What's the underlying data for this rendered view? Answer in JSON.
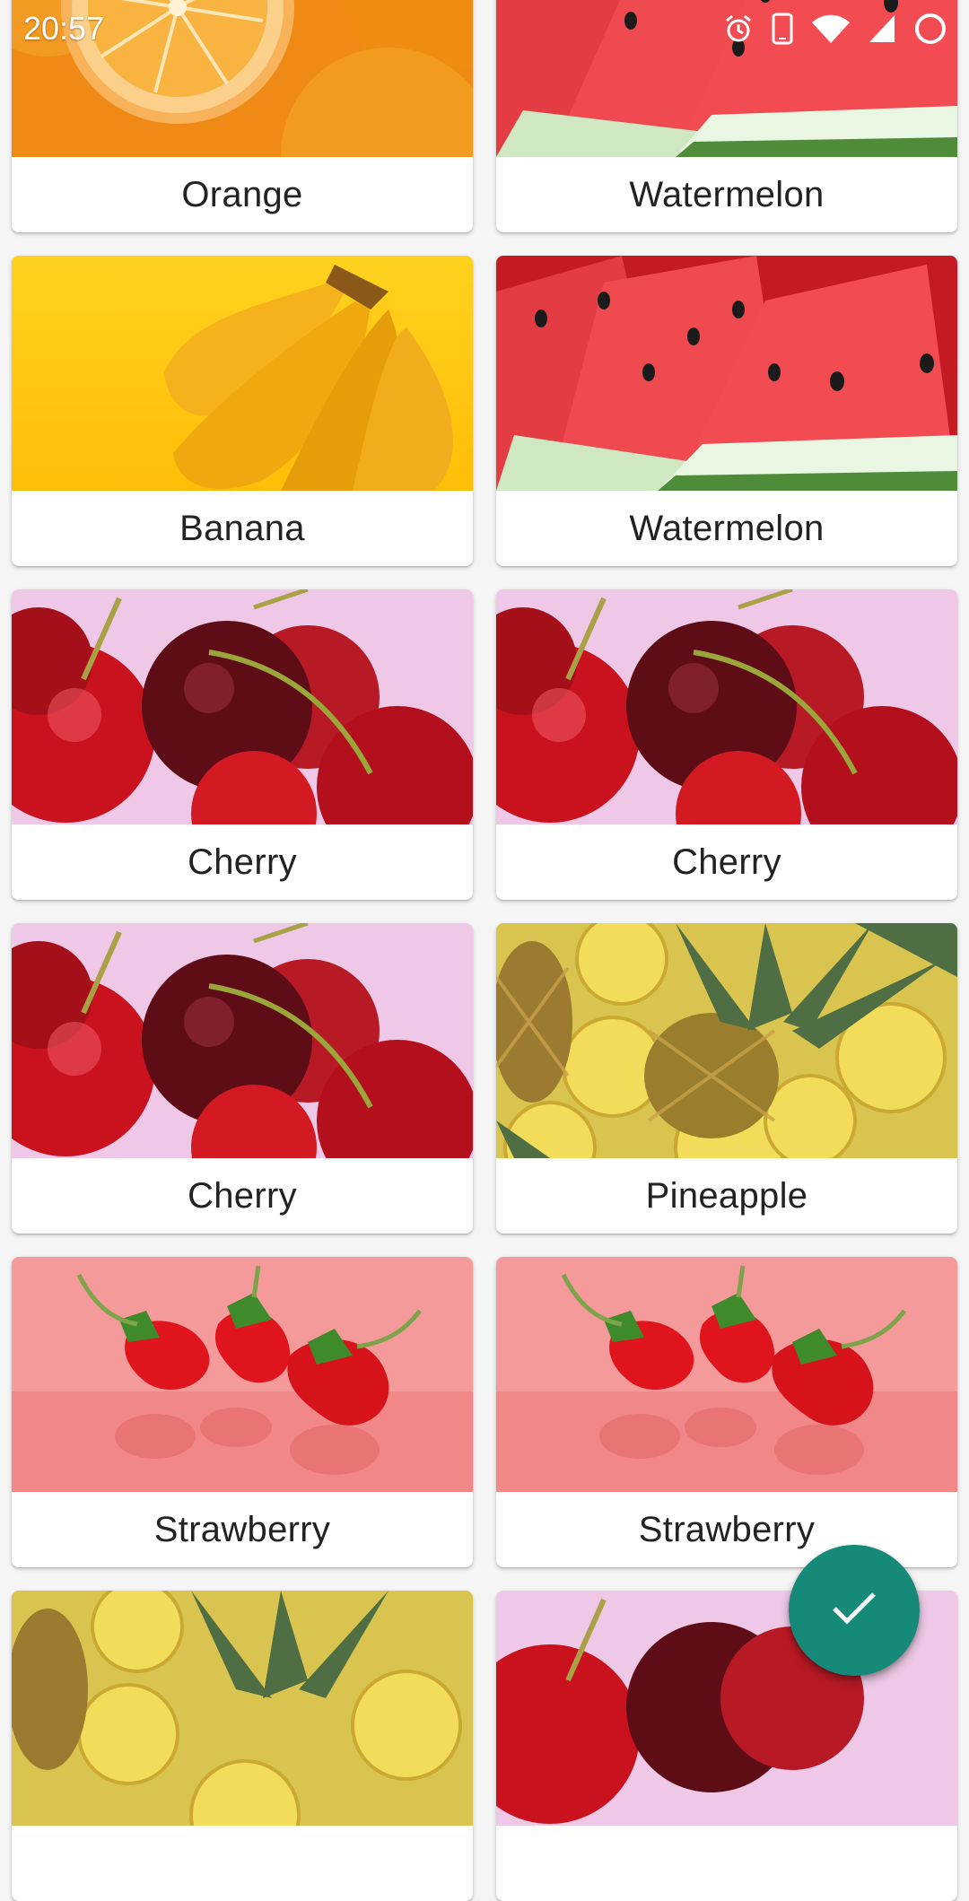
{
  "status_bar": {
    "time": "20:57",
    "icons": [
      "alarm-icon",
      "phone-outline-icon",
      "wifi-icon",
      "cell-signal-icon",
      "battery-ring-icon"
    ]
  },
  "fruits": [
    {
      "name": "Orange",
      "image": "orange-photo"
    },
    {
      "name": "Watermelon",
      "image": "watermelon-photo"
    },
    {
      "name": "Banana",
      "image": "banana-photo"
    },
    {
      "name": "Watermelon",
      "image": "watermelon-photo"
    },
    {
      "name": "Cherry",
      "image": "cherry-photo"
    },
    {
      "name": "Cherry",
      "image": "cherry-photo"
    },
    {
      "name": "Cherry",
      "image": "cherry-photo"
    },
    {
      "name": "Pineapple",
      "image": "pineapple-photo"
    },
    {
      "name": "Strawberry",
      "image": "strawberry-photo"
    },
    {
      "name": "Strawberry",
      "image": "strawberry-photo"
    },
    {
      "name": "",
      "image": "pineapple-photo"
    },
    {
      "name": "",
      "image": "cherry-photo"
    }
  ],
  "fab": {
    "icon": "check-icon",
    "color": "#168a78"
  }
}
